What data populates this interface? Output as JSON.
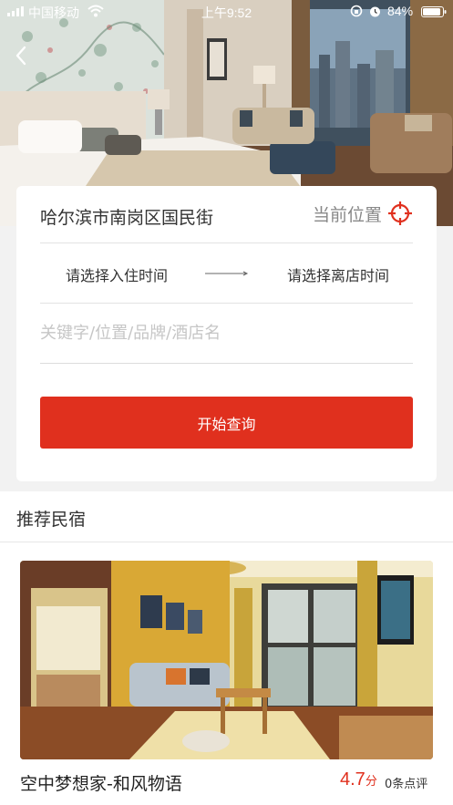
{
  "status_bar": {
    "carrier": "中国移动",
    "time": "上午9:52",
    "battery": "84%"
  },
  "search": {
    "location": "哈尔滨市南岗区国民街",
    "current_location_label": "当前位置",
    "checkin_label": "请选择入住时间",
    "checkout_label": "请选择离店时间",
    "keyword_placeholder": "关键字/位置/品牌/酒店名",
    "keyword_value": "",
    "button_label": "开始查询"
  },
  "recommendations": {
    "title": "推荐民宿",
    "items": [
      {
        "name": "空中梦想家-和风物语",
        "score": "4.7",
        "score_unit": "分",
        "reviews": "0条点评"
      }
    ]
  },
  "colors": {
    "accent": "#e0301e",
    "text": "#333333",
    "placeholder": "#c6c6c6"
  },
  "icons": {
    "back": "chevron-left-icon",
    "locate": "crosshair-icon"
  }
}
